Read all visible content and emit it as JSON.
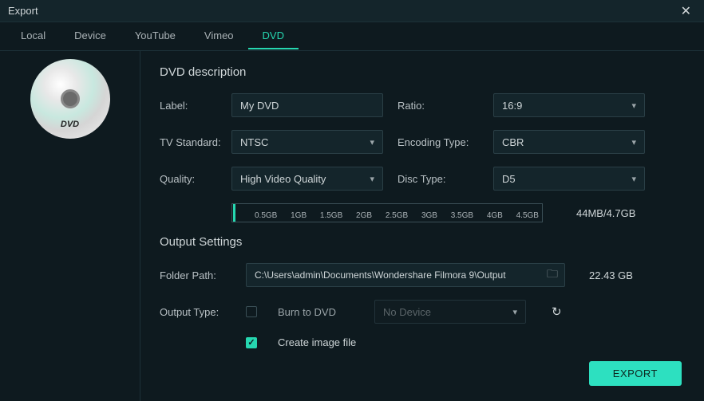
{
  "window": {
    "title": "Export"
  },
  "tabs": {
    "local": "Local",
    "device": "Device",
    "youtube": "YouTube",
    "vimeo": "Vimeo",
    "dvd": "DVD"
  },
  "dvd_icon_label": "DVD",
  "desc": {
    "title": "DVD description",
    "label_label": "Label:",
    "label_value": "My DVD",
    "ratio_label": "Ratio:",
    "ratio_value": "16:9",
    "tvstd_label": "TV Standard:",
    "tvstd_value": "NTSC",
    "enc_label": "Encoding Type:",
    "enc_value": "CBR",
    "quality_label": "Quality:",
    "quality_value": "High Video Quality",
    "disc_label": "Disc Type:",
    "disc_value": "D5",
    "ruler_ticks": [
      "0.5GB",
      "1GB",
      "1.5GB",
      "2GB",
      "2.5GB",
      "3GB",
      "3.5GB",
      "4GB",
      "4.5GB"
    ],
    "size_text": "44MB/4.7GB"
  },
  "output": {
    "title": "Output Settings",
    "folder_label": "Folder Path:",
    "folder_value": "C:\\Users\\admin\\Documents\\Wondershare Filmora 9\\Output",
    "free_space": "22.43 GB",
    "type_label": "Output Type:",
    "burn_label": "Burn to DVD",
    "device_value": "No Device",
    "image_label": "Create image file"
  },
  "export_btn": "EXPORT"
}
